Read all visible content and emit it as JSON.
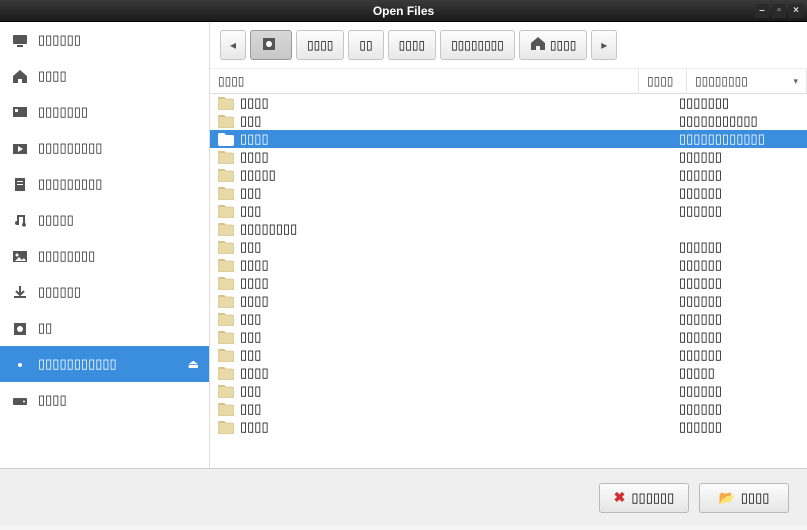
{
  "window": {
    "title": "Open Files"
  },
  "sidebar": {
    "items": [
      {
        "label": "▯▯▯▯▯▯",
        "icon": "computer"
      },
      {
        "label": "▯▯▯▯",
        "icon": "home"
      },
      {
        "label": "▯▯▯▯▯▯▯",
        "icon": "desktop"
      },
      {
        "label": "▯▯▯▯▯▯▯▯▯",
        "icon": "videos"
      },
      {
        "label": "▯▯▯▯▯▯▯▯▯",
        "icon": "documents"
      },
      {
        "label": "▯▯▯▯▯",
        "icon": "music"
      },
      {
        "label": "▯▯▯▯▯▯▯▯",
        "icon": "pictures"
      },
      {
        "label": "▯▯▯▯▯▯",
        "icon": "downloads"
      },
      {
        "label": "▯▯",
        "icon": "disk"
      },
      {
        "label": "▯▯▯▯▯▯▯▯▯▯▯",
        "icon": "disk2",
        "eject": true
      },
      {
        "label": "▯▯▯▯",
        "icon": "drive"
      }
    ],
    "selected": 9
  },
  "breadcrumb": {
    "items": [
      {
        "label": "",
        "icon": "device",
        "active": true
      },
      {
        "label": "▯▯▯▯"
      },
      {
        "label": "▯▯"
      },
      {
        "label": "▯▯▯▯"
      },
      {
        "label": "▯▯▯▯▯▯▯▯"
      },
      {
        "label": "▯▯▯▯",
        "icon": "home"
      }
    ]
  },
  "columns": {
    "name": "▯▯▯▯",
    "size": "▯▯▯▯",
    "modified": "▯▯▯▯▯▯▯▯"
  },
  "files": [
    {
      "name": "▯▯▯▯",
      "mod": "▯▯▯▯▯▯▯"
    },
    {
      "name": "▯▯▯",
      "mod": "▯▯▯▯▯▯▯▯▯▯▯"
    },
    {
      "name": "▯▯▯▯",
      "mod": "▯▯▯▯▯▯▯▯▯▯▯▯",
      "selected": true
    },
    {
      "name": "▯▯▯▯",
      "mod": "▯▯▯▯▯▯"
    },
    {
      "name": "▯▯▯▯▯",
      "mod": "▯▯▯▯▯▯"
    },
    {
      "name": "▯▯▯",
      "mod": "▯▯▯▯▯▯"
    },
    {
      "name": "▯▯▯",
      "mod": "▯▯▯▯▯▯"
    },
    {
      "name": "▯▯▯▯▯▯▯▯",
      "mod": ""
    },
    {
      "name": "▯▯▯",
      "mod": "▯▯▯▯▯▯"
    },
    {
      "name": "▯▯▯▯",
      "mod": "▯▯▯▯▯▯"
    },
    {
      "name": "▯▯▯▯",
      "mod": "▯▯▯▯▯▯"
    },
    {
      "name": "▯▯▯▯",
      "mod": "▯▯▯▯▯▯"
    },
    {
      "name": "▯▯▯",
      "mod": "▯▯▯▯▯▯"
    },
    {
      "name": "▯▯▯",
      "mod": "▯▯▯▯▯▯"
    },
    {
      "name": "▯▯▯",
      "mod": "▯▯▯▯▯▯"
    },
    {
      "name": "▯▯▯▯",
      "mod": "▯▯▯▯▯"
    },
    {
      "name": "▯▯▯",
      "mod": "▯▯▯▯▯▯"
    },
    {
      "name": "▯▯▯",
      "mod": "▯▯▯▯▯▯"
    },
    {
      "name": "▯▯▯▯",
      "mod": "▯▯▯▯▯▯"
    }
  ],
  "buttons": {
    "cancel": "▯▯▯▯▯▯",
    "open": "▯▯▯▯"
  }
}
